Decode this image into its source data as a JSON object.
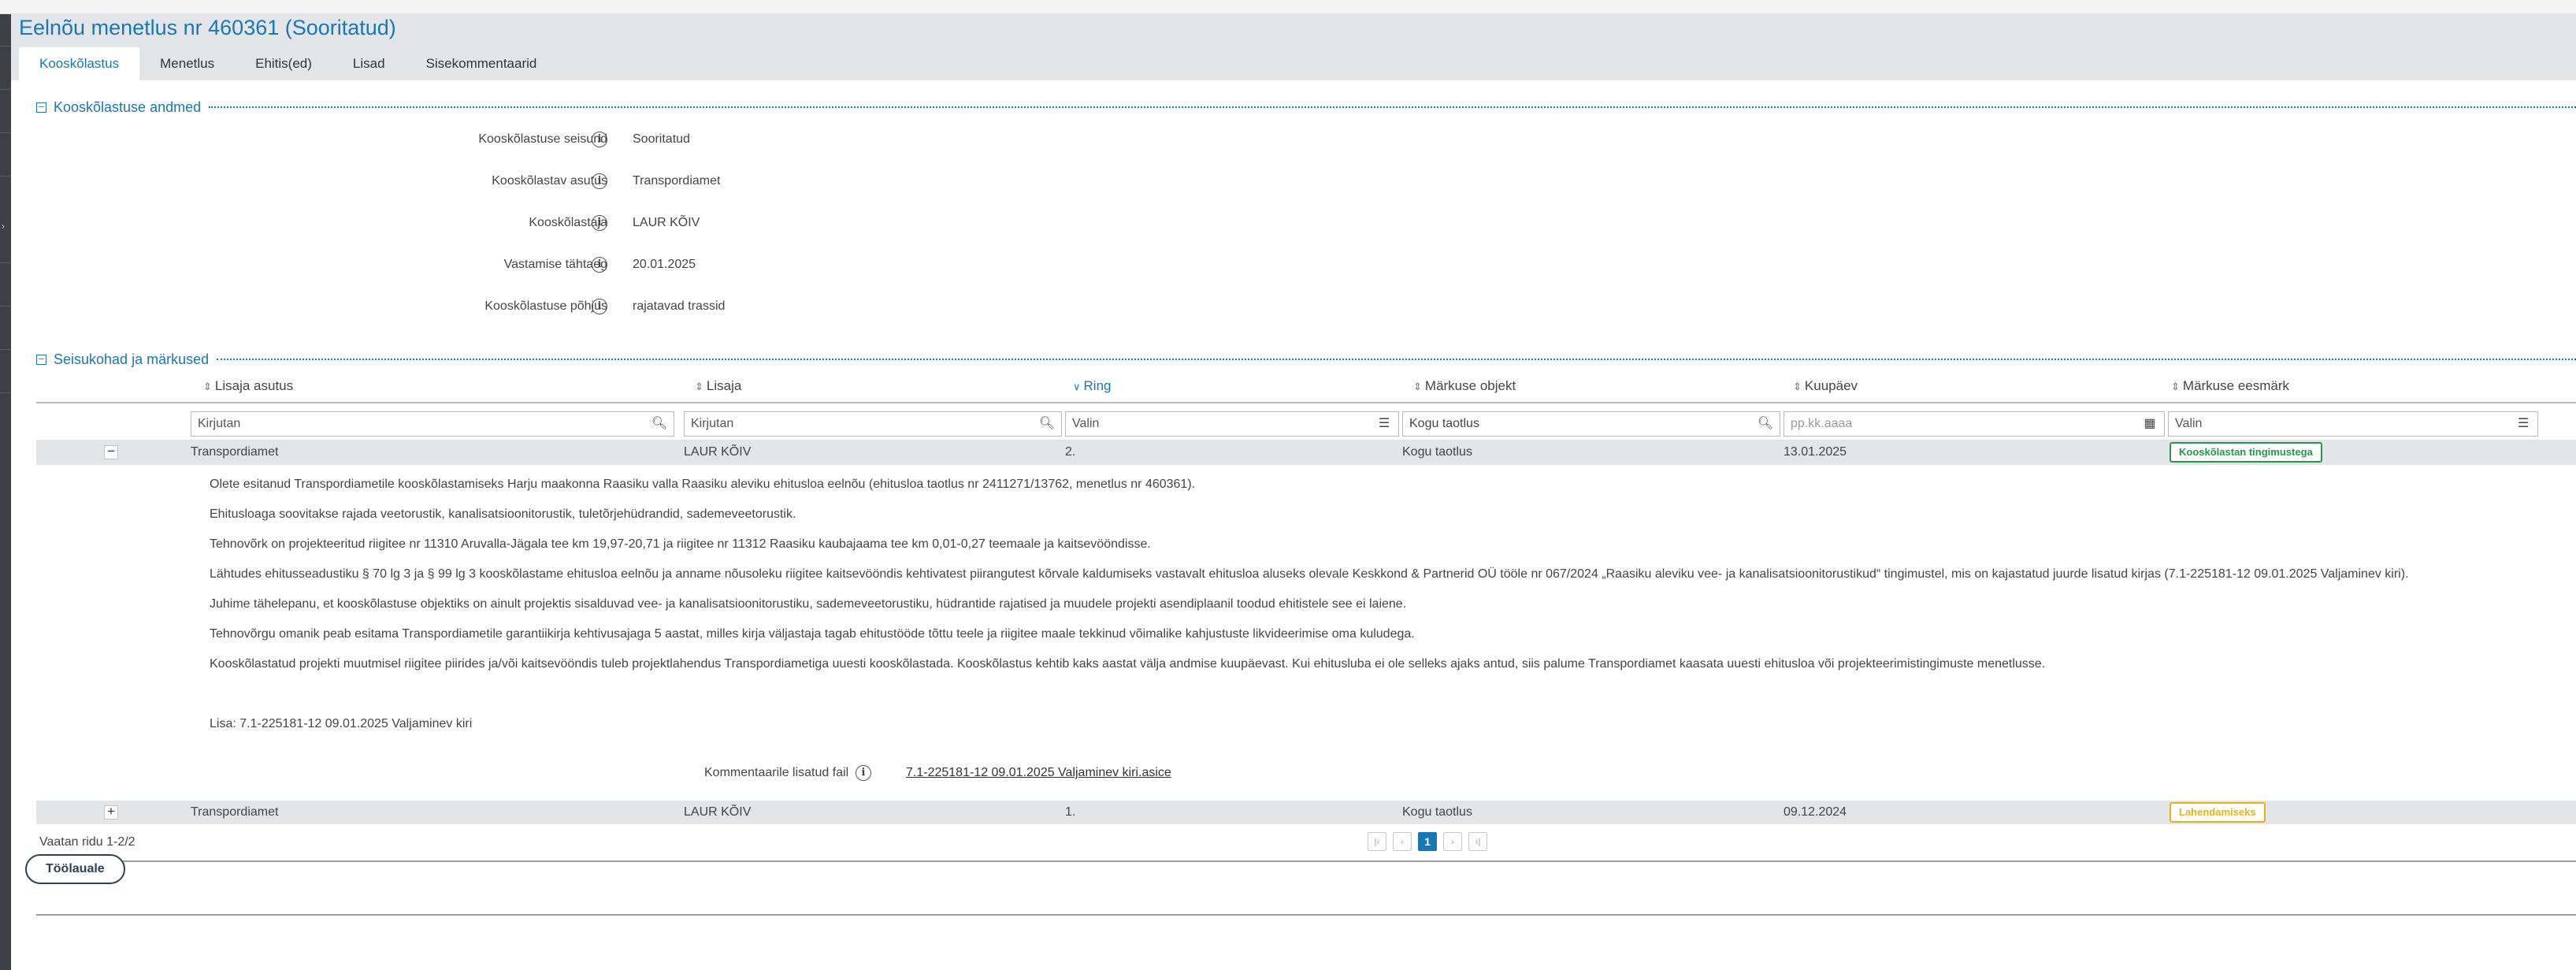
{
  "header": {
    "title": "Eelnõu menetlus nr 460361 (Sooritatud)",
    "tabs": [
      "Kooskõlastus",
      "Menetlus",
      "Ehitis(ed)",
      "Lisad",
      "Sisekommentaarid"
    ],
    "active_tab": "Kooskõlastus"
  },
  "section1": {
    "title": "Kooskõlastuse andmed",
    "fields": [
      {
        "label": "Kooskõlastuse seisund",
        "value": "Sooritatud"
      },
      {
        "label": "Kooskõlastav asutus",
        "value": "Transpordiamet"
      },
      {
        "label": "Kooskõlastaja",
        "value": "LAUR KÕIV"
      },
      {
        "label": "Vastamise tähtaeg",
        "value": "20.01.2025"
      },
      {
        "label": "Kooskõlastuse põhjus",
        "value": "rajatavad trassid"
      }
    ]
  },
  "section2": {
    "title": "Seisukohad ja märkused",
    "columns": [
      "Lisaja asutus",
      "Lisaja",
      "Ring",
      "Märkuse objekt",
      "Kuupäev",
      "Märkuse eesmärk"
    ],
    "filters": {
      "asutus": "Kirjutan",
      "lisaja": "Kirjutan",
      "ring": "Valin",
      "objekt": "Kogu taotlus",
      "kuupaev": "pp.kk.aaaa",
      "eesmark": "Valin"
    },
    "rows": [
      {
        "toggle": "−",
        "asutus": "Transpordiamet",
        "lisaja": "LAUR KÕIV",
        "ring": "2.",
        "objekt": "Kogu taotlus",
        "kuupaev": "13.01.2025",
        "eesmark": "Kooskõlastan tingimustega",
        "status": "green"
      },
      {
        "toggle": "+",
        "asutus": "Transpordiamet",
        "lisaja": "LAUR KÕIV",
        "ring": "1.",
        "objekt": "Kogu taotlus",
        "kuupaev": "09.12.2024",
        "eesmark": "Lahendamiseks",
        "status": "yellow"
      }
    ],
    "details": [
      "Olete esitanud Transpordiametile kooskõlastamiseks Harju maakonna Raasiku valla Raasiku aleviku ehitusloa eelnõu (ehitusloa taotlus nr 2411271/13762, menetlus nr 460361).",
      "Ehitusloaga soovitakse rajada veetorustik, kanalisatsioonitorustik, tuletõrjehüdrandid, sademeveetorustik.",
      "Tehnovõrk on projekteeritud riigitee nr 11310 Aruvalla-Jägala tee km 19,97-20,71 ja riigitee nr 11312 Raasiku kaubajaama tee km 0,01-0,27 teemaale ja kaitsevööndisse.",
      "Lähtudes ehitusseadustiku § 70 lg 3 ja § 99 lg 3 kooskõlastame ehitusloa eelnõu ja anname nõusoleku riigitee kaitsevööndis kehtivatest piirangutest kõrvale kaldumiseks vastavalt ehitusloa aluseks olevale Keskkond & Partnerid OÜ tööle nr 067/2024 „Raasiku aleviku vee- ja kanalisatsioonitorustikud“ tingimustel, mis on kajastatud juurde lisatud kirjas (7.1-225181-12 09.01.2025 Valjaminev kiri).",
      "Juhime tähelepanu, et kooskõlastuse objektiks on ainult projektis sisalduvad vee- ja kanalisatsioonitorustiku, sademeveetorustiku, hüdrantide rajatised ja muudele projekti asendiplaanil toodud ehitistele see ei laiene.",
      "Tehnovõrgu omanik peab esitama Transpordiametile garantiikirja kehtivusajaga 5 aastat, milles kirja väljastaja tagab ehitustööde tõttu teele ja riigitee maale tekkinud võimalike kahjustuste likvideerimise oma kuludega.",
      "Kooskõlastatud projekti muutmisel riigitee piirides ja/või kaitsevööndis tuleb projektlahendus Transpordiametiga uuesti kooskõlastada. Kooskõlastus kehtib kaks aastat välja andmise kuupäevast. Kui ehitusluba ei ole selleks ajaks antud, siis palume Transpordiamet kaasata uuesti ehitusloa või projekteerimistingimuste menetlusse.",
      "Lisa: 7.1-225181-12 09.01.2025 Valjaminev kiri"
    ],
    "attachment_label": "Kommentaarile lisatud fail",
    "attachment_file": "7.1-225181-12 09.01.2025 Valjaminev kiri.asice",
    "pager_text": "Vaatan ridu 1-2/2",
    "pager": {
      "first": "|‹",
      "prev": "‹",
      "current": "1",
      "next": "›",
      "last": "›|"
    }
  },
  "footer": {
    "back_label": "Töölauale"
  }
}
